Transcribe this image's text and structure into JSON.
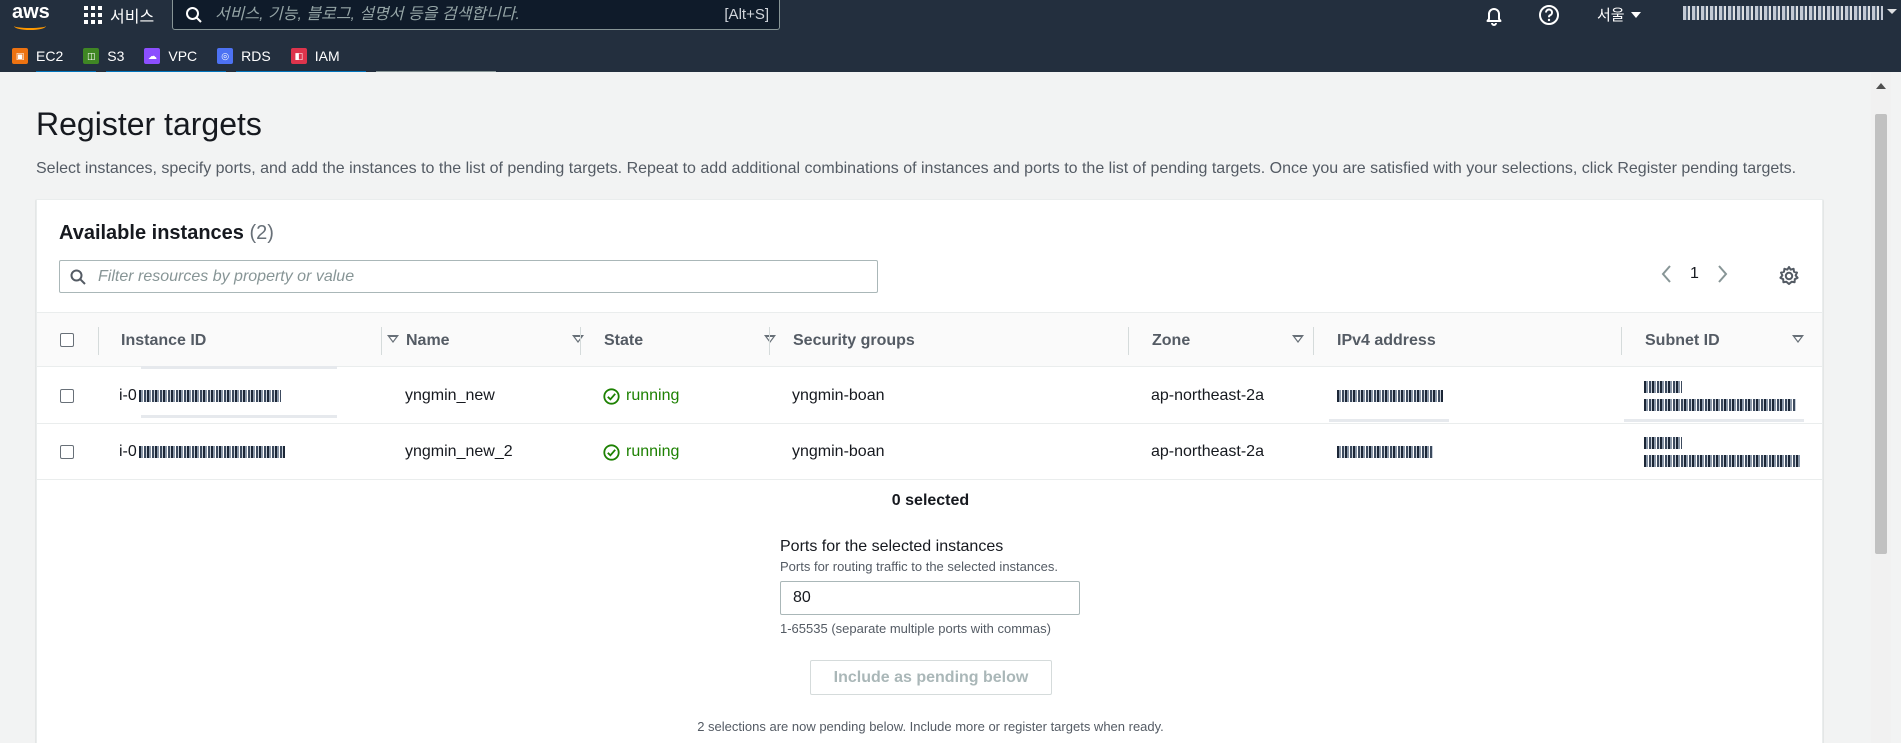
{
  "nav": {
    "logo_text": "aws",
    "services_label": "서비스",
    "search_placeholder": "서비스, 기능, 블로그, 설명서 등을 검색합니다.",
    "search_shortcut": "[Alt+S]",
    "region_label": "서울"
  },
  "favorites": [
    {
      "label": "EC2",
      "color": "#ec7211"
    },
    {
      "label": "S3",
      "color": "#3f8624"
    },
    {
      "label": "VPC",
      "color": "#8c4fff"
    },
    {
      "label": "RDS",
      "color": "#4d72f3"
    },
    {
      "label": "IAM",
      "color": "#dd344c"
    }
  ],
  "page": {
    "title": "Register targets",
    "description": "Select instances, specify ports, and add the instances to the list of pending targets. Repeat to add additional combinations of instances and ports to the list of pending targets. Once you are satisfied with your selections, click Register pending targets."
  },
  "panel": {
    "title": "Available instances",
    "count": "(2)",
    "filter_placeholder": "Filter resources by property or value",
    "page_number": "1"
  },
  "table": {
    "columns": [
      "Instance ID",
      "Name",
      "State",
      "Security groups",
      "Zone",
      "IPv4 address",
      "Subnet ID"
    ],
    "rows": [
      {
        "id_prefix": "i-0",
        "name": "yngmin_new",
        "state": "running",
        "security_group": "yngmin-boan",
        "zone": "ap-northeast-2a"
      },
      {
        "id_prefix": "i-0",
        "name": "yngmin_new_2",
        "state": "running",
        "security_group": "yngmin-boan",
        "zone": "ap-northeast-2a"
      }
    ]
  },
  "selection": {
    "selected_count": "0 selected",
    "ports_label": "Ports for the selected instances",
    "ports_desc": "Ports for routing traffic to the selected instances.",
    "ports_value": "80",
    "ports_hint": "1-65535 (separate multiple ports with commas)",
    "include_button": "Include as pending below",
    "pending_note": "2 selections are now pending below. Include more or register targets when ready."
  },
  "colors": {
    "nav_bg": "#232f3e",
    "status_green": "#1d8102",
    "accent_orange": "#ff9900"
  }
}
